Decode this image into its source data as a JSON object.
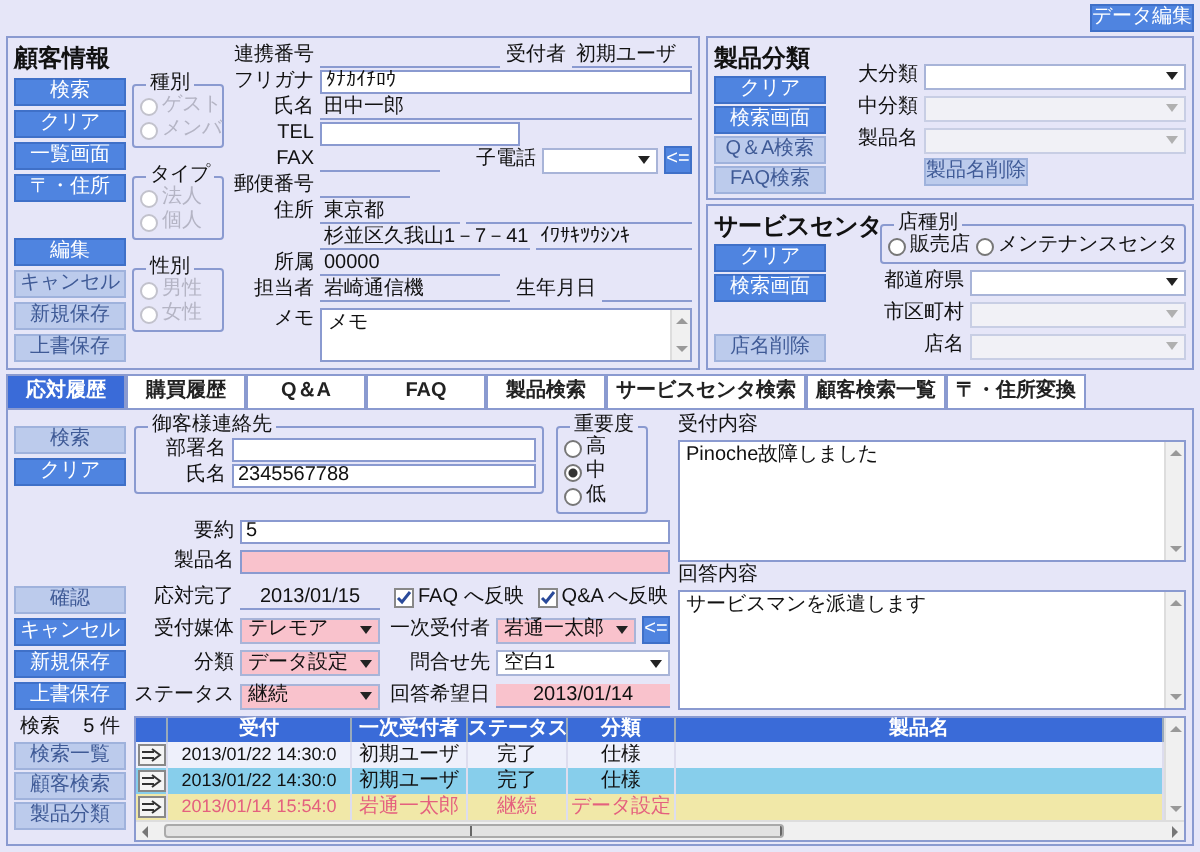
{
  "toolbar": {
    "button": {
      "label": "データ編集",
      "disabled": false
    }
  },
  "customer": {
    "title": "顧客情報",
    "buttons_top": [
      {
        "label": "検索",
        "disabled": false
      },
      {
        "label": "クリア",
        "disabled": false
      },
      {
        "label": "一覧画面",
        "disabled": false
      },
      {
        "label": "〒・住所",
        "disabled": false
      }
    ],
    "buttons_bottom": [
      {
        "label": "編集",
        "disabled": false
      },
      {
        "label": "キャンセル",
        "disabled": true
      },
      {
        "label": "新規保存",
        "disabled": true
      },
      {
        "label": "上書保存",
        "disabled": true
      }
    ],
    "radio_groups": [
      {
        "title": "種別",
        "disabled": true,
        "options": [
          {
            "label": "ゲスト",
            "selected": false
          },
          {
            "label": "メンバ",
            "selected": false
          }
        ]
      },
      {
        "title": "タイプ",
        "disabled": true,
        "options": [
          {
            "label": "法人",
            "selected": false
          },
          {
            "label": "個人",
            "selected": false
          }
        ]
      },
      {
        "title": "性別",
        "disabled": true,
        "options": [
          {
            "label": "男性",
            "selected": false
          },
          {
            "label": "女性",
            "selected": false
          }
        ]
      }
    ],
    "fields": {
      "link_no": {
        "label": "連携番号"
      },
      "receiver": {
        "label": "受付者",
        "value": "初期ユーザ"
      },
      "furigana": {
        "label": "フリガナ",
        "value": "ﾀﾅｶｲﾁﾛｳ"
      },
      "name": {
        "label": "氏名",
        "value": "田中一郎"
      },
      "tel": {
        "label": "TEL"
      },
      "fax": {
        "label": "FAX"
      },
      "child_phone": {
        "label": "子電話",
        "disabled": false
      },
      "arrow_button": "<=",
      "zip": {
        "label": "郵便番号"
      },
      "address": {
        "label": "住所",
        "values": [
          "東京都",
          "杉並区久我山1－7－41",
          "ｲﾜｻｷﾂｳｼﾝｷ"
        ]
      },
      "affiliation": {
        "label": "所属",
        "value": "00000"
      },
      "staff": {
        "label": "担当者",
        "value": "岩崎通信機"
      },
      "birthday": {
        "label": "生年月日"
      },
      "memo": {
        "label": "メモ",
        "value": "メモ"
      }
    }
  },
  "product": {
    "title": "製品分類",
    "buttons": [
      {
        "label": "クリア",
        "disabled": false
      },
      {
        "label": "検索画面",
        "disabled": false
      },
      {
        "label": "Q＆A検索",
        "disabled": true
      },
      {
        "label": "FAQ検索",
        "disabled": true
      }
    ],
    "selects": [
      {
        "label": "大分類",
        "disabled": false
      },
      {
        "label": "中分類",
        "disabled": true
      },
      {
        "label": "製品名",
        "disabled": true
      }
    ],
    "delete_button": {
      "label": "製品名削除",
      "disabled": true
    }
  },
  "service_center": {
    "title": "サービスセンタ",
    "buttons": [
      {
        "label": "クリア",
        "disabled": false
      },
      {
        "label": "検索画面",
        "disabled": false
      }
    ],
    "delete_button": {
      "label": "店名削除",
      "disabled": true
    },
    "store_type": {
      "title": "店種別",
      "options": [
        {
          "label": "販売店",
          "selected": false
        },
        {
          "label": "メンテナンスセンタ",
          "selected": false
        }
      ]
    },
    "selects": [
      {
        "label": "都道府県",
        "disabled": false
      },
      {
        "label": "市区町村",
        "disabled": true
      },
      {
        "label": "店名",
        "disabled": true
      }
    ]
  },
  "tabs": [
    {
      "label": "応対履歴",
      "selected": true
    },
    {
      "label": "購買履歴",
      "selected": false
    },
    {
      "label": "Q＆A",
      "selected": false
    },
    {
      "label": "FAQ",
      "selected": false
    },
    {
      "label": "製品検索",
      "selected": false
    },
    {
      "label": "サービスセンタ検索",
      "selected": false
    },
    {
      "label": "顧客検索一覧",
      "selected": false
    },
    {
      "label": "〒・住所変換",
      "selected": false
    }
  ],
  "response": {
    "buttons_top": [
      {
        "label": "検索",
        "disabled": true
      },
      {
        "label": "クリア",
        "disabled": false
      }
    ],
    "buttons_bottom": [
      {
        "label": "確認",
        "disabled": true
      },
      {
        "label": "キャンセル",
        "disabled": false
      },
      {
        "label": "新規保存",
        "disabled": false
      },
      {
        "label": "上書保存",
        "disabled": false
      }
    ],
    "contact": {
      "title": "御客様連絡先",
      "department": {
        "label": "部署名"
      },
      "name": {
        "label": "氏名",
        "value": "2345567788"
      }
    },
    "importance": {
      "title": "重要度",
      "options": [
        {
          "label": "高",
          "selected": false
        },
        {
          "label": "中",
          "selected": true
        },
        {
          "label": "低",
          "selected": false
        }
      ]
    },
    "summary": {
      "label": "要約",
      "value": "5"
    },
    "product_name": {
      "label": "製品名",
      "highlighted": true
    },
    "completed": {
      "label": "応対完了",
      "value": "2013/01/15"
    },
    "checkboxes": [
      {
        "label": "FAQ へ反映",
        "checked": true
      },
      {
        "label": "Q&A へ反映",
        "checked": true
      }
    ],
    "medium": {
      "label": "受付媒体",
      "value": "テレモア",
      "highlighted": true
    },
    "first_receiver": {
      "label": "一次受付者",
      "value": "岩通一太郎",
      "highlighted": true
    },
    "arrow_button": "<=",
    "category": {
      "label": "分類",
      "value": "データ設定",
      "highlighted": true
    },
    "contact_to": {
      "label": "問合せ先",
      "value": "空白1",
      "highlighted": false
    },
    "status": {
      "label": "ステータス",
      "value": "継続",
      "highlighted": true
    },
    "desired_date": {
      "label": "回答希望日",
      "value": "2013/01/14",
      "highlighted": true
    },
    "reception": {
      "label": "受付内容",
      "value": "Pinoche故障しました"
    },
    "answer": {
      "label": "回答内容",
      "value": "サービスマンを派遣します"
    }
  },
  "results": {
    "label": "検索",
    "count": "5 件",
    "buttons": [
      {
        "label": "検索一覧",
        "disabled": true
      },
      {
        "label": "顧客検索",
        "disabled": true
      },
      {
        "label": "製品分類",
        "disabled": true
      }
    ],
    "table": {
      "columns": [
        "受付",
        "一次受付者",
        "ステータス",
        "分類",
        "製品名"
      ],
      "rows": [
        {
          "cells": [
            "2013/01/22 14:30:0",
            "初期ユーザ",
            "完了",
            "仕様"
          ],
          "selected": false,
          "kind": "normal"
        },
        {
          "cells": [
            "2013/01/22 14:30:0",
            "初期ユーザ",
            "完了",
            "仕様"
          ],
          "selected": true,
          "kind": "normal"
        },
        {
          "cells": [
            "2013/01/14 15:54:0",
            "岩通一太郎",
            "継続",
            "データ設定"
          ],
          "selected": false,
          "kind": "alert"
        }
      ]
    }
  }
}
